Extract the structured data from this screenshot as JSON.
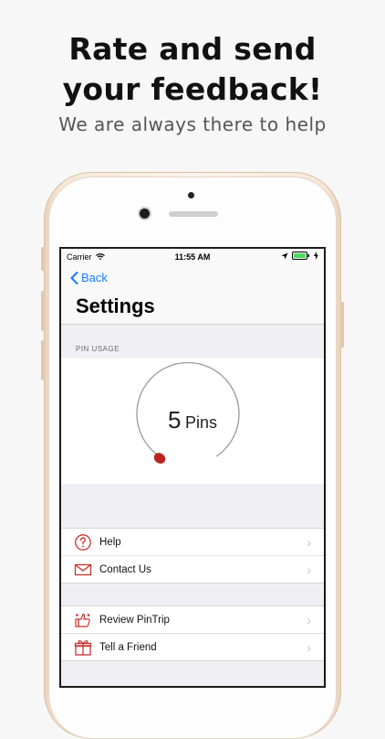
{
  "promo": {
    "headline_line1": "Rate and send",
    "headline_line2": "your feedback!",
    "subheadline": "We are always there to help"
  },
  "status_bar": {
    "carrier": "Carrier",
    "time": "11:55 AM"
  },
  "nav": {
    "back_label": "Back",
    "title": "Settings"
  },
  "pin_usage": {
    "section_label": "PIN USAGE",
    "count": "5",
    "unit": "Pins"
  },
  "menu_groups": [
    {
      "items": [
        {
          "label": "Help",
          "icon": "help-icon"
        },
        {
          "label": "Contact Us",
          "icon": "mail-icon"
        }
      ]
    },
    {
      "items": [
        {
          "label": "Review PinTrip",
          "icon": "thumbs-up-icon"
        },
        {
          "label": "Tell a Friend",
          "icon": "gift-icon"
        }
      ]
    }
  ],
  "colors": {
    "accent": "#147efb",
    "icon_red": "#c8332e",
    "gauge_dot": "#b8241f"
  }
}
